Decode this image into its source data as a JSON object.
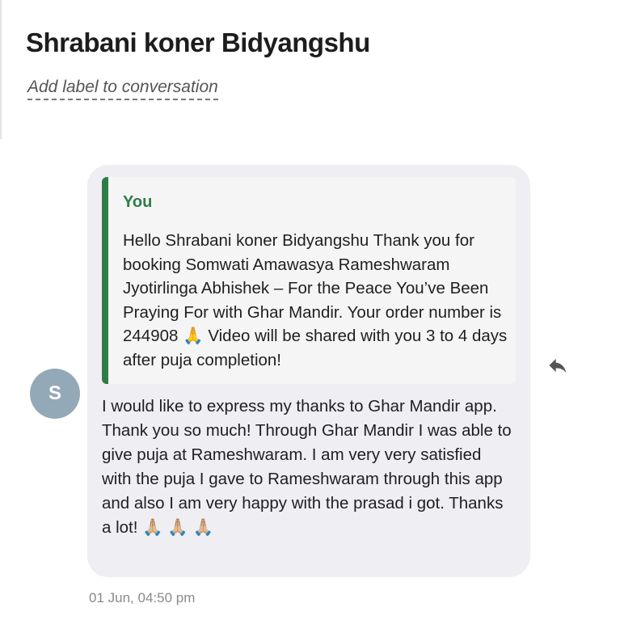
{
  "conversation": {
    "title": "Shrabani koner Bidyangshu",
    "label_link": "Add label to conversation"
  },
  "message": {
    "avatar_initial": "S",
    "quoted": {
      "author": "You",
      "text": "Hello Shrabani koner Bidyangshu Thank you for booking Somwati Amawasya Rameshwaram Jyotirlinga Abhishek – For the Peace You’ve Been Praying For with Ghar Mandir. Your order number is 244908 🙏 Video will be shared with you 3 to 4 days after puja completion!"
    },
    "body": "I would like to express my thanks to Ghar Mandir app. Thank you so much! Through Ghar Mandir I was able to give puja at Rameshwaram. I am very very satisfied with the puja I gave to Rameshwaram through this app and also I am very happy with the prasad i got. Thanks a lot! 🙏🏼 🙏🏼 🙏🏼",
    "timestamp": "01 Jun, 04:50 pm"
  },
  "icons": {
    "reply": "reply-icon"
  },
  "colors": {
    "quote_accent": "#2e7d48",
    "bubble_bg": "#eeeef3",
    "avatar_bg": "#93a9b8"
  }
}
